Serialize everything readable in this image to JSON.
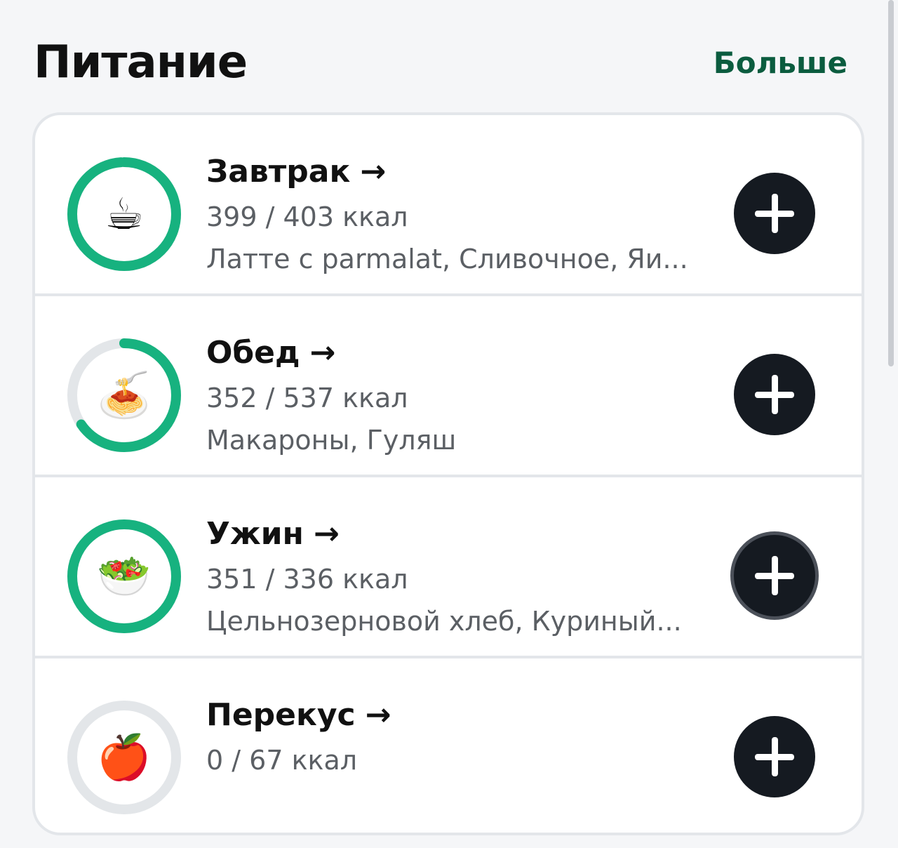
{
  "header": {
    "title": "Питание",
    "more_label": "Больше"
  },
  "colors": {
    "ring_progress": "#17b27f",
    "ring_track": "#e3e6e9",
    "add_button": "#151a21",
    "more_link": "#0b5c3f"
  },
  "meals": [
    {
      "name": "Завтрак",
      "arrow": "→",
      "kcal": "399 / 403 ккал",
      "items": "Латте с parmalat, Сливочное, Яи...",
      "icon": "coffee-icon",
      "glyph": "☕",
      "progress": 0.99
    },
    {
      "name": "Обед",
      "arrow": "→",
      "kcal": "352 / 537 ккал",
      "items": "Макароны, Гуляш",
      "icon": "spaghetti-icon",
      "glyph": "🍝",
      "progress": 0.655
    },
    {
      "name": "Ужин",
      "arrow": "→",
      "kcal": "351 / 336 ккал",
      "items": "Цельнозерновой хлеб, Куриный...",
      "icon": "salad-icon",
      "glyph": "🥗",
      "progress": 1.0
    },
    {
      "name": "Перекус",
      "arrow": "→",
      "kcal": "0 / 67 ккал",
      "items": "",
      "icon": "apple-icon",
      "glyph": "🍎",
      "progress": 0
    }
  ]
}
